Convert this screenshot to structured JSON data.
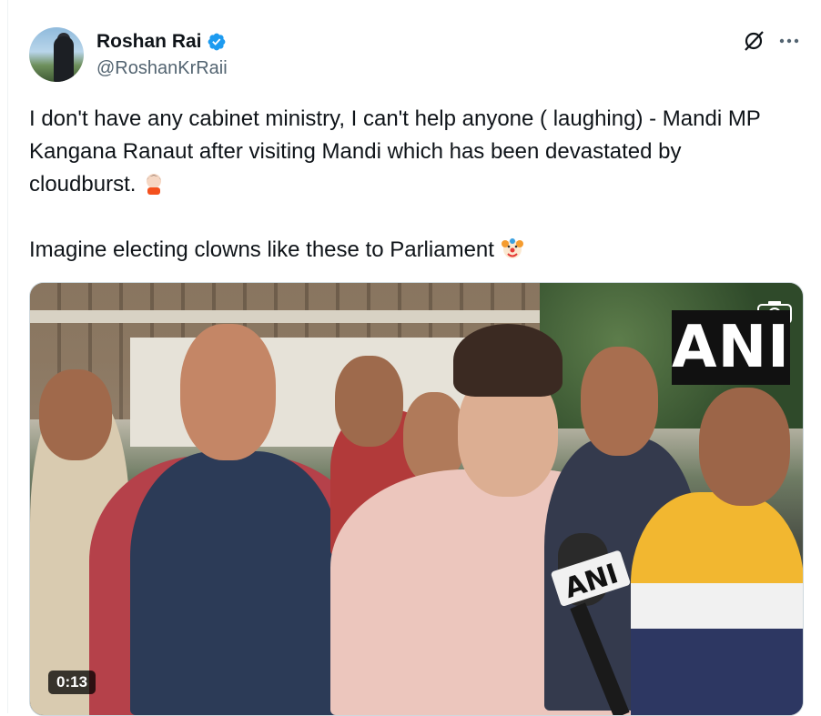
{
  "author": {
    "display_name": "Roshan Rai",
    "handle": "@RoshanKrRaii",
    "verified_icon": "verified-badge-icon",
    "verified_color": "#1d9bf0"
  },
  "header_actions": {
    "grok_icon": "grok-icon",
    "more_icon": "more-icon"
  },
  "tweet": {
    "line1": "I don't have any cabinet ministry, I can't help anyone ( laughing) - Mandi MP Kangana Ranaut after visiting Mandi which has been devastated by cloudburst. ",
    "emoji1": "facepalm-emoji",
    "line2": "Imagine electing clowns like these to Parliament ",
    "emoji2": "clown-emoji"
  },
  "media": {
    "watermark": "ANI",
    "mic_label": "ANI",
    "duration": "0:13",
    "camera_icon": "camera-icon"
  }
}
